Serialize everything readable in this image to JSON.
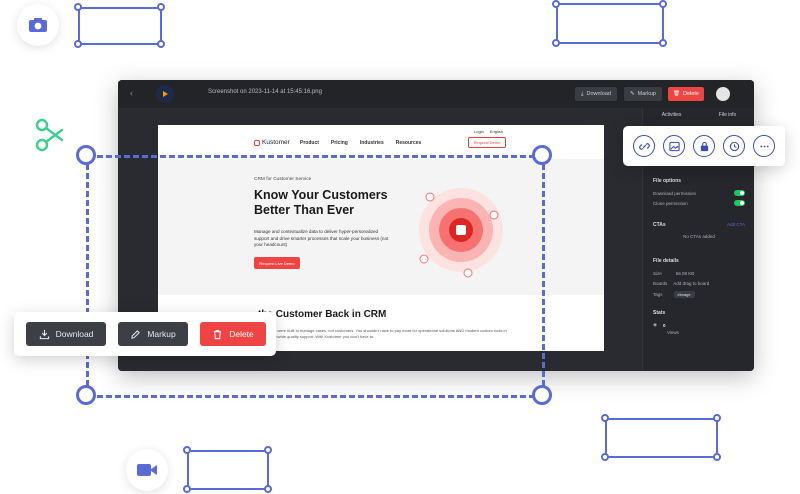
{
  "app": {
    "back_glyph": "‹",
    "title": "Screenshot on 2023-11-14 at 15:45:16.png",
    "download_label": "Download",
    "markup_label": "Markup",
    "delete_label": "Delete"
  },
  "screenshot": {
    "brand": "Kustomer",
    "menu": [
      "Product",
      "Pricing",
      "Industries",
      "Resources"
    ],
    "util_links": [
      "Login",
      "English"
    ],
    "demo_button": "Request Demo",
    "eyebrow": "CRM for Customer Service",
    "headline": "Know Your Customers Better Than Ever",
    "body": "Manage and contextualize data to deliver hyper-personalized support and drive smarter processes that scale your business (not your headcount)",
    "cta": "Request Live Demo",
    "section_heading": "the Customer Back in CRM",
    "section_body": "Most tools were built to manage cases, not customers. You shouldn't have to pay more for operational solutions AND modern custom tools in order to provide quality support. With Kustomer you don't have to."
  },
  "sidebar": {
    "tabs": [
      "Activities",
      "File info"
    ],
    "file_options_heading": "File options",
    "options": [
      "Download permission",
      "Clone permission"
    ],
    "ctas_heading": "CTAs",
    "ctas_add": "Add CTA",
    "ctas_empty": "No CTAs added",
    "file_details_heading": "File details",
    "details": [
      {
        "label": "Size",
        "value": "56.08 KB"
      },
      {
        "label": "Boards",
        "value": "Add drag to board"
      },
      {
        "label": "Tags",
        "value": "#image"
      }
    ],
    "stats_heading": "Stats",
    "views_count": "0",
    "views_label": "Views"
  },
  "actions": {
    "download": "Download",
    "markup": "Markup",
    "delete": "Delete"
  },
  "colors": {
    "accent": "#5b6bd6",
    "danger": "#ef4444",
    "toggle_on": "#22c55e",
    "scissors": "#3ecf8e",
    "app_bg": "#2a2b30"
  },
  "icons": {
    "top_left": "camera-icon",
    "bottom": "video-icon",
    "toolbar": [
      "link-icon",
      "image-icon",
      "lock-icon",
      "clock-icon",
      "more-icon"
    ],
    "cut": "scissors-icon"
  }
}
